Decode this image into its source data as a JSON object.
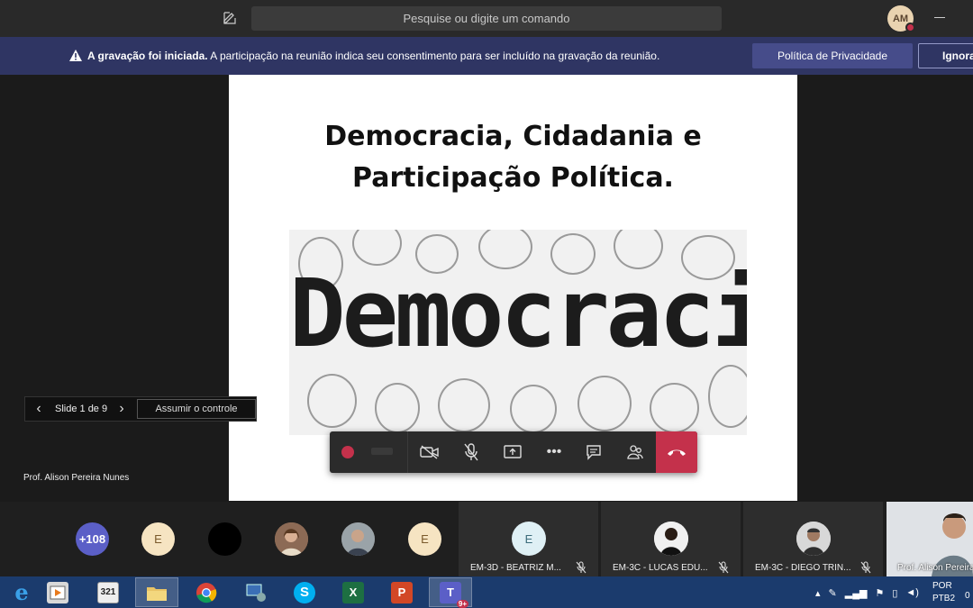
{
  "titlebar": {
    "search_placeholder": "Pesquise ou digite um comando",
    "avatar_initials": "AM"
  },
  "banner": {
    "bold": "A gravação foi iniciada.",
    "text": " A participação na reunião indica seu consentimento para ser incluído na gravação da reunião.",
    "privacy_button": "Política de Privacidade",
    "ignore_button": "Ignorar"
  },
  "slide": {
    "title_line1": "Democracia, Cidadania e",
    "title_line2": "Participação Política.",
    "image_word": "Democracia"
  },
  "slide_nav": {
    "counter": "Slide 1 de 9",
    "take_control": "Assumir o controle"
  },
  "presenter": {
    "name": "Prof. Alison Pereira Nunes"
  },
  "participants": {
    "more_count": "+108",
    "letter_avatars": [
      "E",
      "E"
    ],
    "tiles": [
      {
        "name": "EM-3D - BEATRIZ M...",
        "initial": "E"
      },
      {
        "name": "EM-3C - LUCAS EDU...",
        "initial": ""
      },
      {
        "name": "EM-3C - DIEGO TRIN...",
        "initial": ""
      }
    ],
    "self_name": "Prof. Alison Pereira"
  },
  "taskbar": {
    "lang_line1": "POR",
    "lang_line2": "PTB2",
    "clock": "0",
    "teams_badge": "9+"
  },
  "colors": {
    "banner": "#2f3563",
    "accent": "#5b5fc7",
    "hangup": "#c4314b",
    "taskbar": "#1b3b6d"
  }
}
